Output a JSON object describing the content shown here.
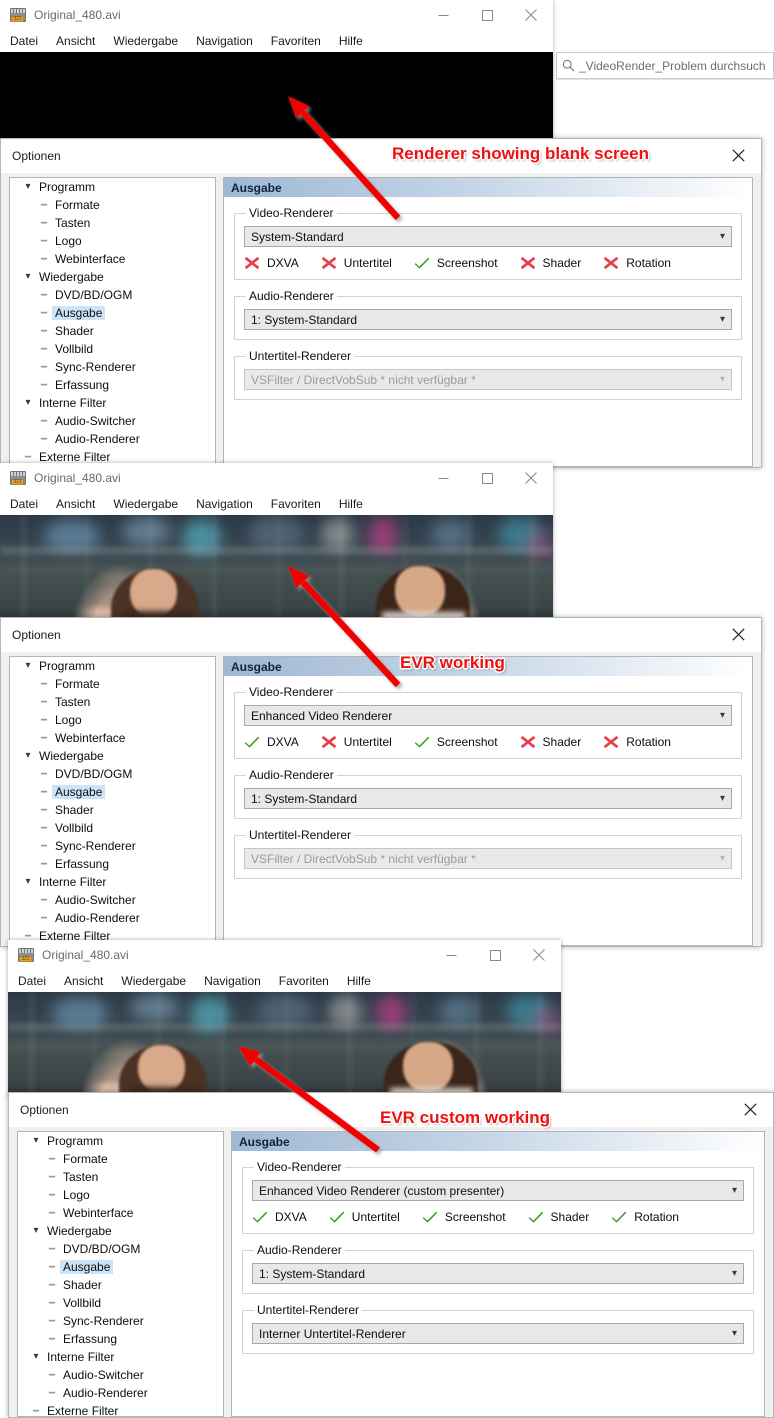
{
  "explorer": {
    "search_icon": "search-icon",
    "search_placeholder": "_VideoRender_Problem durchsuch"
  },
  "player": {
    "title": "Original_480.avi",
    "icon": "film-clapper-icon",
    "menu": [
      "Datei",
      "Ansicht",
      "Wiedergabe",
      "Navigation",
      "Favoriten",
      "Hilfe"
    ],
    "buttons": {
      "minimize": "minimize-icon",
      "maximize": "maximize-icon",
      "close": "close-icon"
    }
  },
  "options": {
    "title": "Optionen",
    "close_icon": "close-icon",
    "pane_header": "Ausgabe",
    "groups": {
      "video": "Video-Renderer",
      "audio": "Audio-Renderer",
      "subtitle": "Untertitel-Renderer"
    },
    "tree": [
      {
        "label": "Programm",
        "level": 0,
        "expander": "chevron-down",
        "selected": false
      },
      {
        "label": "Formate",
        "level": 1,
        "expander": "dots",
        "selected": false
      },
      {
        "label": "Tasten",
        "level": 1,
        "expander": "dots",
        "selected": false
      },
      {
        "label": "Logo",
        "level": 1,
        "expander": "dots",
        "selected": false
      },
      {
        "label": "Webinterface",
        "level": 1,
        "expander": "dots-end",
        "selected": false
      },
      {
        "label": "Wiedergabe",
        "level": 0,
        "expander": "chevron-down",
        "selected": false
      },
      {
        "label": "DVD/BD/OGM",
        "level": 1,
        "expander": "dots",
        "selected": false
      },
      {
        "label": "Ausgabe",
        "level": 1,
        "expander": "dots",
        "selected": true
      },
      {
        "label": "Shader",
        "level": 1,
        "expander": "dots",
        "selected": false
      },
      {
        "label": "Vollbild",
        "level": 1,
        "expander": "dots",
        "selected": false
      },
      {
        "label": "Sync-Renderer",
        "level": 1,
        "expander": "dots",
        "selected": false
      },
      {
        "label": "Erfassung",
        "level": 1,
        "expander": "dots-end",
        "selected": false
      },
      {
        "label": "Interne Filter",
        "level": 0,
        "expander": "chevron-down",
        "selected": false
      },
      {
        "label": "Audio-Switcher",
        "level": 1,
        "expander": "dots",
        "selected": false
      },
      {
        "label": "Audio-Renderer",
        "level": 1,
        "expander": "dots-end",
        "selected": false
      },
      {
        "label": "Externe Filter",
        "level": 0,
        "expander": "dots",
        "selected": false
      }
    ],
    "capability_labels": [
      "DXVA",
      "Untertitel",
      "Screenshot",
      "Shader",
      "Rotation"
    ]
  },
  "panels": [
    {
      "id": "panel-system-standard",
      "annotation": "Renderer showing blank screen",
      "video_renderer": "System-Standard",
      "audio_renderer": "1: System-Standard",
      "subtitle_renderer": "VSFilter / DirectVobSub * nicht verfügbar *",
      "subtitle_disabled": true,
      "capabilities": [
        false,
        false,
        true,
        false,
        false
      ],
      "video_blank": true
    },
    {
      "id": "panel-evr",
      "annotation": "EVR working",
      "video_renderer": "Enhanced Video Renderer",
      "audio_renderer": "1: System-Standard",
      "subtitle_renderer": "VSFilter / DirectVobSub * nicht verfügbar *",
      "subtitle_disabled": true,
      "capabilities": [
        true,
        false,
        true,
        false,
        false
      ],
      "video_blank": false
    },
    {
      "id": "panel-evr-custom",
      "annotation": "EVR custom working",
      "video_renderer": "Enhanced Video Renderer (custom presenter)",
      "audio_renderer": "1: System-Standard",
      "subtitle_renderer": "Interner Untertitel-Renderer",
      "subtitle_disabled": false,
      "capabilities": [
        true,
        true,
        true,
        true,
        true
      ],
      "video_blank": false
    }
  ],
  "colors": {
    "check_green": "#3aa021",
    "cross_red": "#e8404a",
    "annotation_red": "#ee1111",
    "selection_blue": "#cce4f7",
    "pane_header_blue": "#9fb8d4"
  }
}
